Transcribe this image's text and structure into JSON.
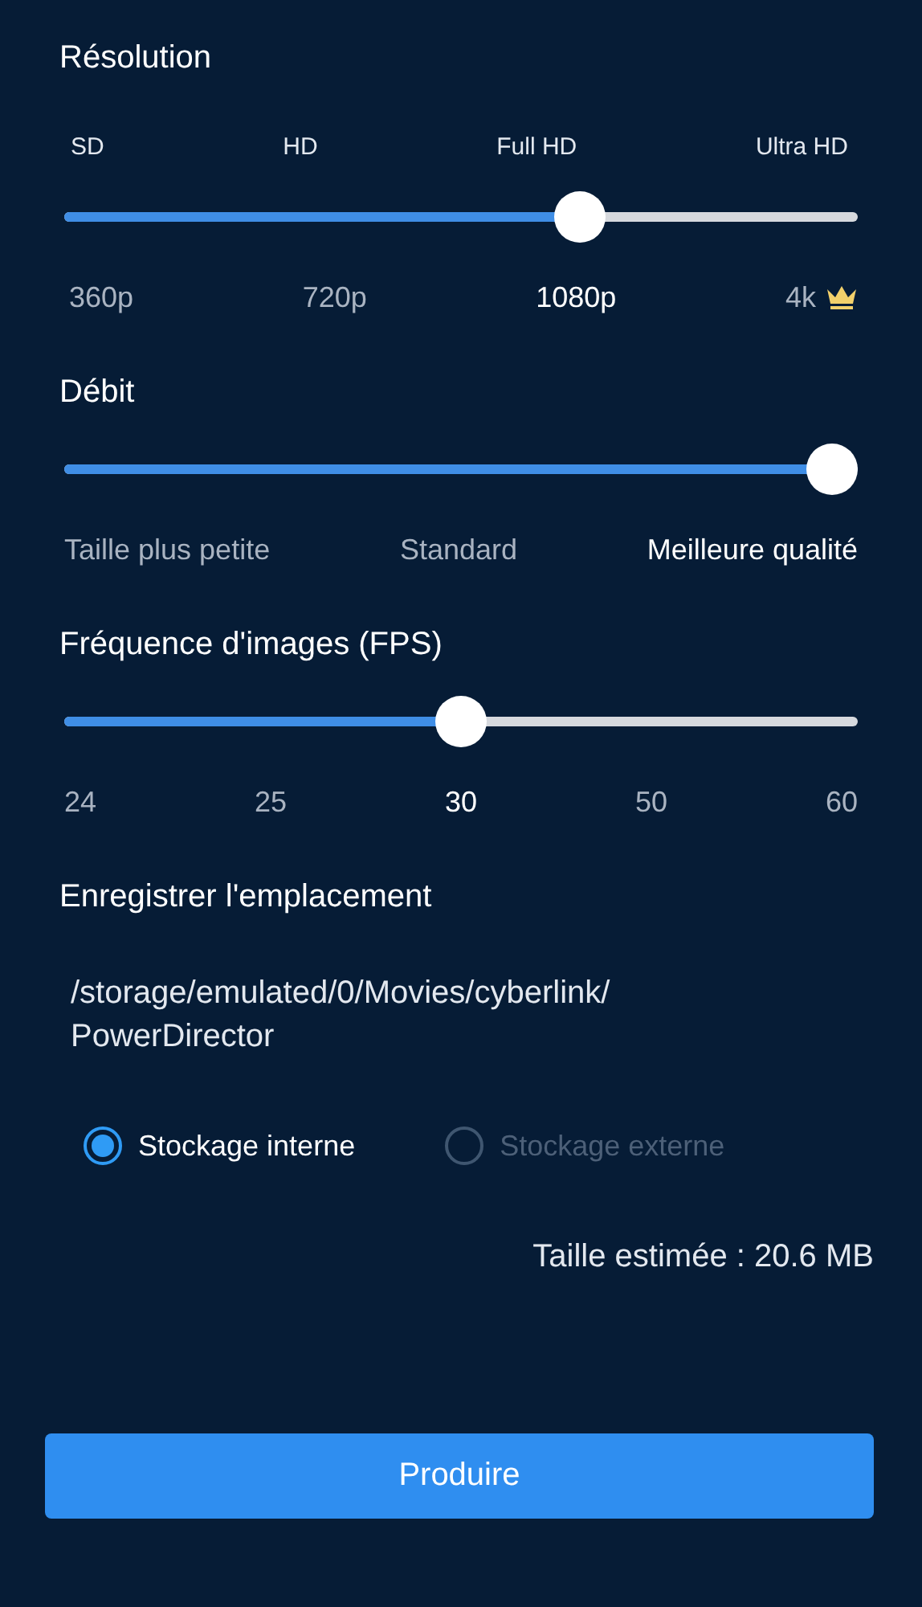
{
  "sections": [
    {
      "kind": "slider",
      "title": "Résolution",
      "level": 0.66,
      "tiers": [
        "SD",
        "HD",
        "Full HD",
        "Ultra HD"
      ],
      "options": [
        {
          "label": "360p",
          "selected": false,
          "premium": false
        },
        {
          "label": "720p",
          "selected": false,
          "premium": false
        },
        {
          "label": "1080p",
          "selected": true,
          "premium": false
        },
        {
          "label": "4k",
          "selected": false,
          "premium": true
        }
      ]
    },
    {
      "kind": "slider",
      "title": "Débit",
      "level": 1,
      "options": [
        {
          "label": "Taille plus petite",
          "selected": false,
          "premium": false
        },
        {
          "label": "Standard",
          "selected": false,
          "premium": false
        },
        {
          "label": "Meilleure qualité",
          "selected": true,
          "premium": false
        }
      ]
    },
    {
      "kind": "slider",
      "title": "Fréquence d'images (FPS)",
      "level": 0.5,
      "options": [
        {
          "label": "24",
          "selected": false,
          "premium": false
        },
        {
          "label": "25",
          "selected": false,
          "premium": false
        },
        {
          "label": "30",
          "selected": true,
          "premium": false
        },
        {
          "label": "50",
          "selected": false,
          "premium": false
        },
        {
          "label": "60",
          "selected": false,
          "premium": false
        }
      ]
    }
  ],
  "location": {
    "title": "Enregistrer l'emplacement",
    "path": "/storage/emulated/0/Movies/cyberlink/\nPowerDirector",
    "storage": [
      {
        "label": "Stockage interne",
        "selected": true,
        "disabled": false
      },
      {
        "label": "Stockage externe",
        "selected": false,
        "disabled": true
      }
    ]
  },
  "estimate": "Taille estimée : 20.6 MB",
  "button": "Produire"
}
